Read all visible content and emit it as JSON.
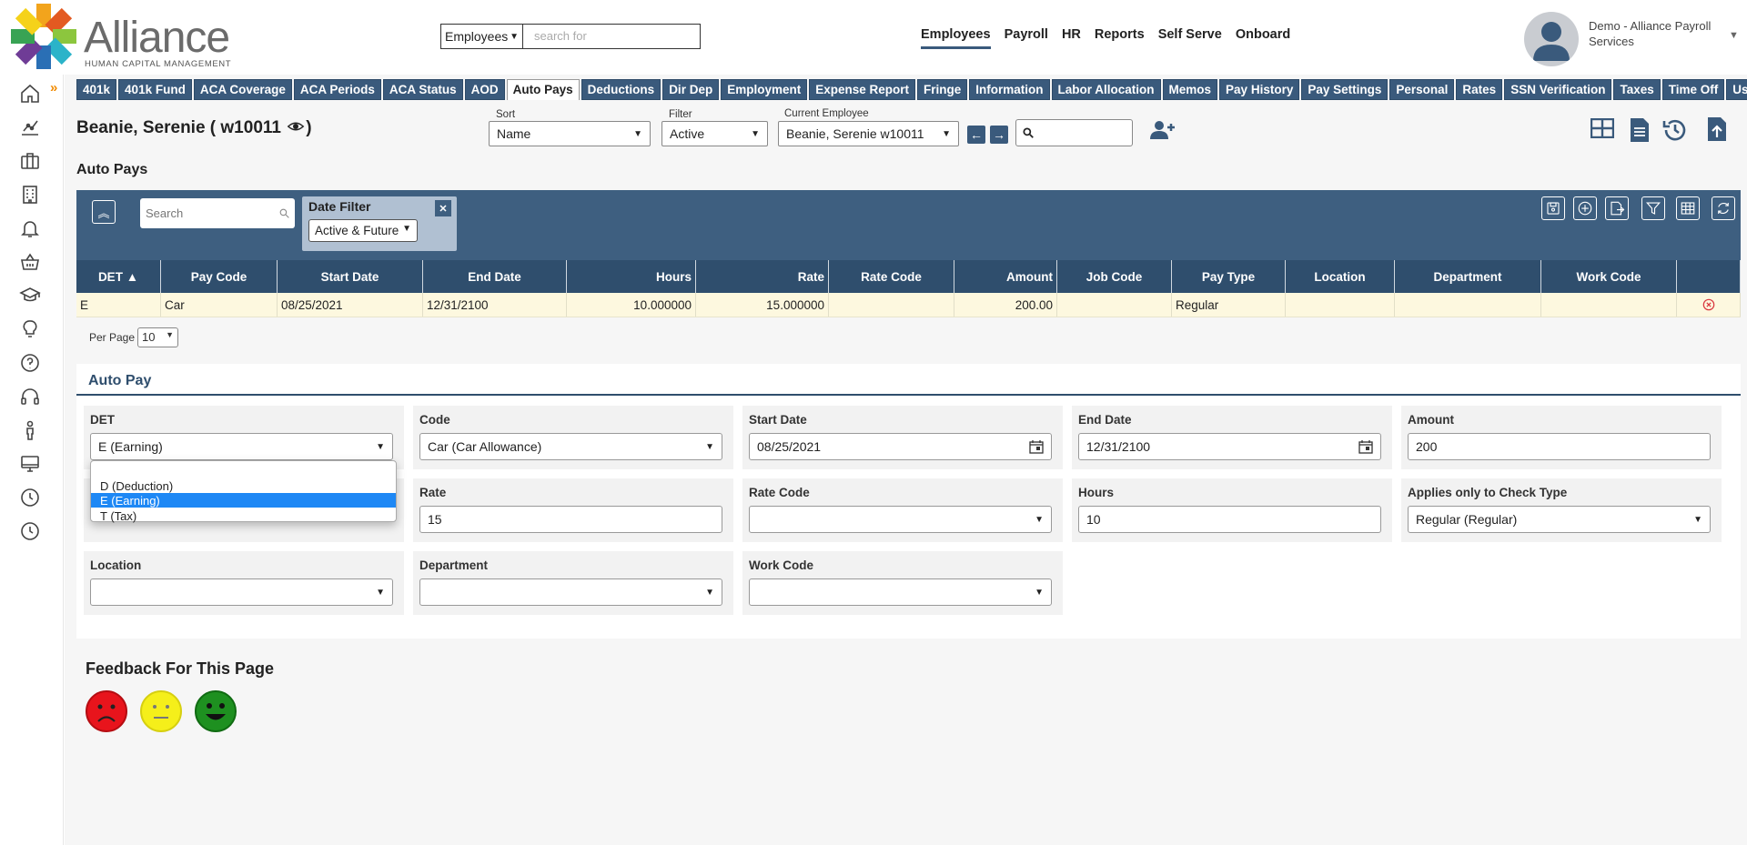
{
  "brand": {
    "name": "Alliance",
    "subtitle": "HUMAN CAPITAL MANAGEMENT",
    "accent": "#3a5a7c"
  },
  "header_search": {
    "scope": "Employees",
    "placeholder": "search for"
  },
  "topnav": [
    {
      "label": "Employees",
      "active": true
    },
    {
      "label": "Payroll"
    },
    {
      "label": "HR"
    },
    {
      "label": "Reports"
    },
    {
      "label": "Self Serve"
    },
    {
      "label": "Onboard"
    }
  ],
  "user": {
    "name": "Demo - Alliance Payroll Services"
  },
  "tabs": [
    "401k",
    "401k Fund",
    "ACA Coverage",
    "ACA Periods",
    "ACA Status",
    "AOD",
    "Auto Pays",
    "Deductions",
    "Dir Dep",
    "Employment",
    "Expense Report",
    "Fringe",
    "Information",
    "Labor Allocation",
    "Memos",
    "Pay History",
    "Pay Settings",
    "Personal",
    "Rates",
    "SSN Verification",
    "Taxes",
    "Time Off",
    "User Defined"
  ],
  "active_tab": "Auto Pays",
  "employee": {
    "title": "Beanie, Serenie ( w10011"
  },
  "controls": {
    "sort_label": "Sort",
    "sort_value": "Name",
    "filter_label": "Filter",
    "filter_value": "Active",
    "current_label": "Current Employee",
    "current_value": "Beanie, Serenie w10011"
  },
  "section_title": "Auto Pays",
  "grid": {
    "search_placeholder": "Search",
    "date_filter_title": "Date Filter",
    "date_filter_value": "Active & Future",
    "per_page_label": "Per Page",
    "per_page_value": "10"
  },
  "table": {
    "columns": [
      "DET ▲",
      "Pay Code",
      "Start Date",
      "End Date",
      "Hours",
      "Rate",
      "Rate Code",
      "Amount",
      "Job Code",
      "Pay Type",
      "Location",
      "Department",
      "Work Code",
      ""
    ],
    "rows": [
      [
        "E",
        "Car",
        "08/25/2021",
        "12/31/2100",
        "10.000000",
        "15.000000",
        "",
        "200.00",
        "",
        "Regular",
        "",
        "",
        ""
      ]
    ]
  },
  "form": {
    "title": "Auto Pay",
    "det_label": "DET",
    "det_value": "E (Earning)",
    "code_label": "Code",
    "code_value": "Car (Car Allowance)",
    "start_label": "Start Date",
    "start_value": "08/25/2021",
    "end_label": "End Date",
    "end_value": "12/31/2100",
    "amount_label": "Amount",
    "amount_value": "200",
    "rate_label": "Rate",
    "rate_value": "15",
    "ratecode_label": "Rate Code",
    "ratecode_value": "",
    "hours_label": "Hours",
    "hours_value": "10",
    "checktype_label": "Applies only to Check Type",
    "checktype_value": "Regular (Regular)",
    "location_label": "Location",
    "location_value": "",
    "department_label": "Department",
    "department_value": "",
    "workcode_label": "Work Code",
    "workcode_value": ""
  },
  "det_options": [
    "",
    "D (Deduction)",
    "E (Earning)",
    "T (Tax)"
  ],
  "det_selected": "E (Earning)",
  "feedback": {
    "title": "Feedback For This Page"
  },
  "colors": {
    "nav_blue": "#3a5a7c",
    "header_blue": "#2f4e6d",
    "row_highlight": "#fdf8df",
    "selected_option": "#1e88f5",
    "sad": "#e8141c",
    "neutral": "#f5ef1a",
    "happy": "#1e9020"
  }
}
